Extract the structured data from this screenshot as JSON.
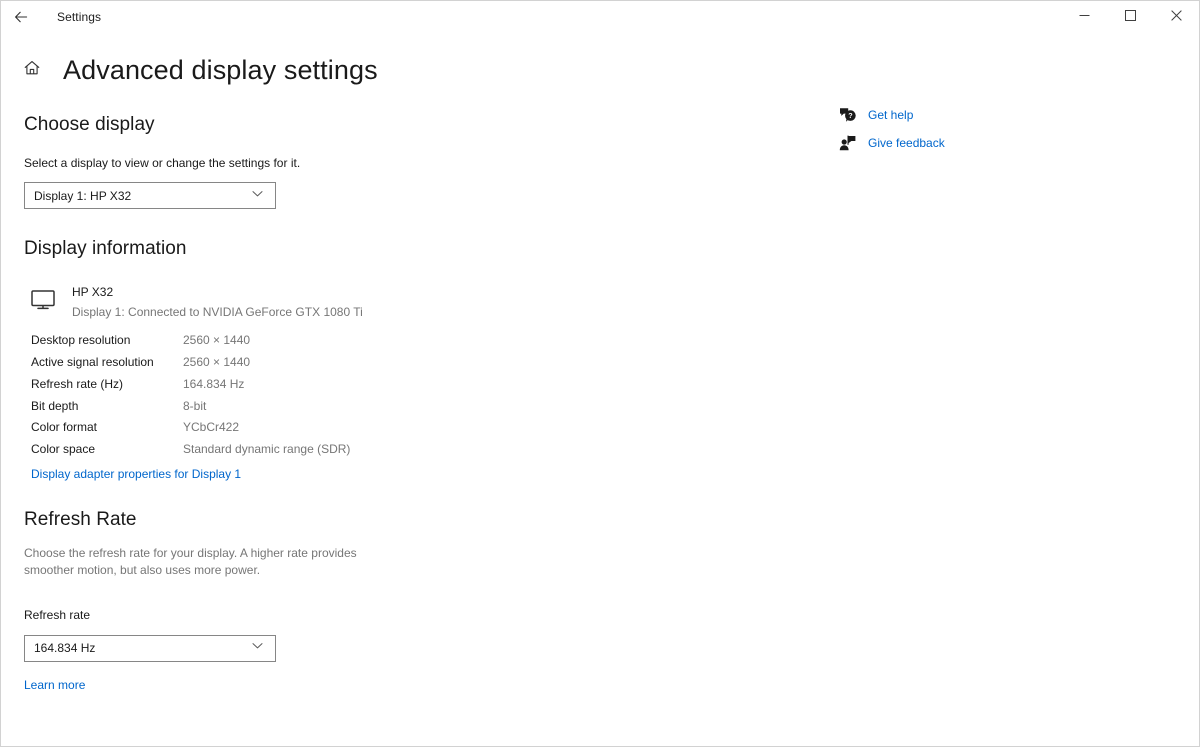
{
  "window": {
    "titlebar_title": "Settings",
    "back_icon": "back-arrow-icon",
    "minimize_label": "Minimize",
    "maximize_label": "Maximize",
    "close_label": "Close"
  },
  "header": {
    "home_icon": "home-icon",
    "page_title": "Advanced display settings"
  },
  "choose_display": {
    "heading": "Choose display",
    "description": "Select a display to view or change the settings for it.",
    "selected_display": "Display 1: HP X32",
    "options": [
      "Display 1: HP X32"
    ]
  },
  "display_information": {
    "heading": "Display information",
    "monitor_icon": "monitor-icon",
    "display_name": "HP X32",
    "display_connection": "Display 1: Connected to NVIDIA GeForce GTX 1080 Ti",
    "rows": [
      {
        "label": "Desktop resolution",
        "value": "2560 × 1440"
      },
      {
        "label": "Active signal resolution",
        "value": "2560 × 1440"
      },
      {
        "label": "Refresh rate (Hz)",
        "value": "164.834 Hz"
      },
      {
        "label": "Bit depth",
        "value": "8-bit"
      },
      {
        "label": "Color format",
        "value": "YCbCr422"
      },
      {
        "label": "Color space",
        "value": "Standard dynamic range (SDR)"
      }
    ],
    "adapter_link": "Display adapter properties for Display 1"
  },
  "refresh_rate": {
    "heading": "Refresh Rate",
    "description": "Choose the refresh rate for your display. A higher rate provides smoother motion, but also uses more power.",
    "field_label": "Refresh rate",
    "selected_rate": "164.834 Hz",
    "options": [
      "164.834 Hz"
    ],
    "learn_more": "Learn more"
  },
  "help_panel": {
    "items": [
      {
        "label": "Get help",
        "icon": "help-bubble-icon"
      },
      {
        "label": "Give feedback",
        "icon": "feedback-person-icon"
      }
    ]
  },
  "colors": {
    "link": "#0066cc",
    "text_primary": "#1a1a1a",
    "text_secondary": "#767676",
    "background": "#ffffff",
    "border": "#868686"
  }
}
